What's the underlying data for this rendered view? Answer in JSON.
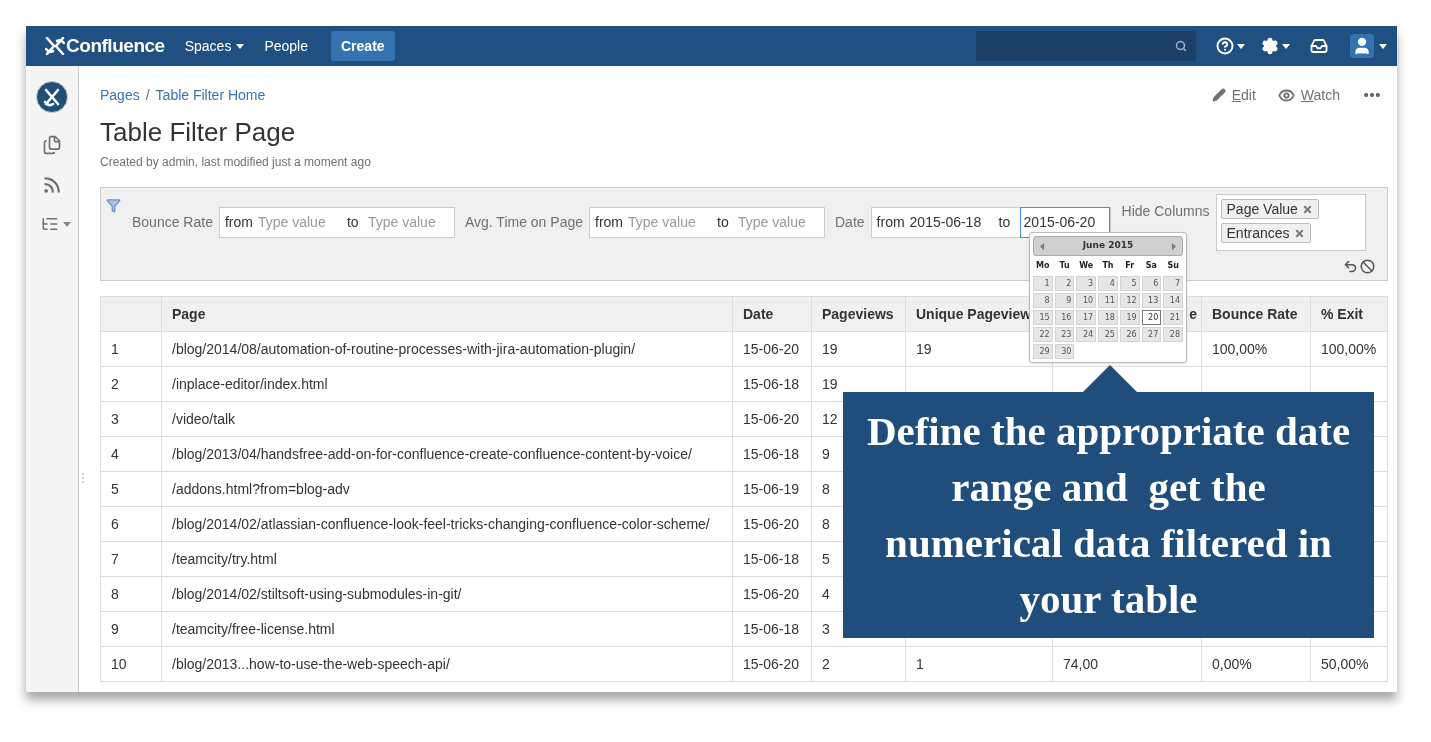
{
  "nav": {
    "logo": "Confluence",
    "items": [
      {
        "label": "Spaces",
        "dropdown": true
      },
      {
        "label": "People",
        "dropdown": false
      }
    ],
    "create": "Create"
  },
  "breadcrumbs": {
    "separator": "/",
    "items": [
      "Pages",
      "Table Filter Home"
    ]
  },
  "actions": [
    {
      "kind": "edit",
      "label": "Edit"
    },
    {
      "kind": "watch",
      "label": "Watch"
    }
  ],
  "page": {
    "title": "Table Filter Page",
    "byline": "Created by admin, last modified just a moment ago"
  },
  "filters": [
    {
      "label": "Bounce Rate",
      "from_label": "from",
      "to_label": "to",
      "from_placeholder": "Type value",
      "to_placeholder": "Type value"
    },
    {
      "label": "Avg. Time on Page",
      "from_label": "from",
      "to_label": "to",
      "from_placeholder": "Type value",
      "to_placeholder": "Type value"
    },
    {
      "label": "Date",
      "from_label": "from",
      "to_label": "to",
      "from_value": "2015-06-18",
      "to_value": "2015-06-20"
    }
  ],
  "hide_columns": {
    "label": "Hide Columns",
    "tags": [
      "Page Value",
      "Entrances"
    ]
  },
  "calendar": {
    "month": "June 2015",
    "weekdays": [
      "Mo",
      "Tu",
      "We",
      "Th",
      "Fr",
      "Sa",
      "Su"
    ],
    "days": [
      {
        "day": "1",
        "selected": false
      },
      {
        "day": "2",
        "selected": false
      },
      {
        "day": "3",
        "selected": false
      },
      {
        "day": "4",
        "selected": false
      },
      {
        "day": "5",
        "selected": false
      },
      {
        "day": "6",
        "selected": false
      },
      {
        "day": "7",
        "selected": false
      },
      {
        "day": "8",
        "selected": false
      },
      {
        "day": "9",
        "selected": false
      },
      {
        "day": "10",
        "selected": false
      },
      {
        "day": "11",
        "selected": false
      },
      {
        "day": "12",
        "selected": false
      },
      {
        "day": "13",
        "selected": false
      },
      {
        "day": "14",
        "selected": false
      },
      {
        "day": "15",
        "selected": false
      },
      {
        "day": "16",
        "selected": false
      },
      {
        "day": "17",
        "selected": false
      },
      {
        "day": "18",
        "selected": false
      },
      {
        "day": "19",
        "selected": false
      },
      {
        "day": "20",
        "selected": true
      },
      {
        "day": "21",
        "selected": false
      },
      {
        "day": "22",
        "selected": false
      },
      {
        "day": "23",
        "selected": false
      },
      {
        "day": "24",
        "selected": false
      },
      {
        "day": "25",
        "selected": false
      },
      {
        "day": "26",
        "selected": false
      },
      {
        "day": "27",
        "selected": false
      },
      {
        "day": "28",
        "selected": false
      },
      {
        "day": "29",
        "selected": false
      },
      {
        "day": "30",
        "selected": false
      }
    ]
  },
  "table": {
    "columns": [
      "",
      "Page",
      "Date",
      "Pageviews",
      "Unique Pageview",
      "e",
      "Bounce Rate",
      "% Exit"
    ],
    "rows": [
      [
        "1",
        "/blog/2014/08/automation-of-routine-processes-with-jira-automation-plugin/",
        "15-06-20",
        "19",
        "19",
        null,
        "100,00%",
        "100,00%"
      ],
      [
        "2",
        "/inplace-editor/index.html",
        "15-06-18",
        "19",
        null,
        null,
        null,
        null
      ],
      [
        "3",
        "/video/talk",
        "15-06-20",
        "12",
        null,
        null,
        null,
        null
      ],
      [
        "4",
        "/blog/2013/04/handsfree-add-on-for-confluence-create-confluence-content-by-voice/",
        "15-06-18",
        "9",
        null,
        null,
        null,
        null
      ],
      [
        "5",
        "/addons.html?from=blog-adv",
        "15-06-19",
        "8",
        null,
        null,
        null,
        null
      ],
      [
        "6",
        "/blog/2014/02/atlassian-confluence-look-feel-tricks-changing-confluence-color-scheme/",
        "15-06-20",
        "8",
        null,
        null,
        null,
        null
      ],
      [
        "7",
        "/teamcity/try.html",
        "15-06-18",
        "5",
        null,
        null,
        null,
        null
      ],
      [
        "8",
        "/blog/2014/02/stiltsoft-using-submodules-in-git/",
        "15-06-20",
        "4",
        null,
        null,
        null,
        null
      ],
      [
        "9",
        "/teamcity/free-license.html",
        "15-06-18",
        "3",
        null,
        null,
        null,
        null
      ],
      [
        "10",
        "/blog/2013...how-to-use-the-web-speech-api/",
        "15-06-20",
        "2",
        "1",
        "74,00",
        "0,00%",
        "50,00%"
      ]
    ]
  },
  "callout": "Define the appropriate date range and  get the numerical data filtered in your table"
}
